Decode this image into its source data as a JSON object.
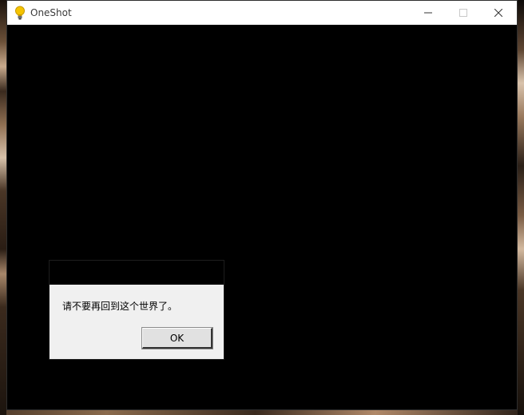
{
  "window": {
    "title": "OneShot",
    "icon": "lightbulb-icon",
    "controls": {
      "minimize": "minimize-icon",
      "maximize": "maximize-icon",
      "close": "close-icon"
    }
  },
  "dialog": {
    "message": "请不要再回到这个世界了。",
    "ok_label": "OK"
  },
  "colors": {
    "client_background": "#000000",
    "dialog_background": "#f0f0f0",
    "titlebar_background": "#ffffff",
    "icon_bulb": "#f5c400"
  }
}
